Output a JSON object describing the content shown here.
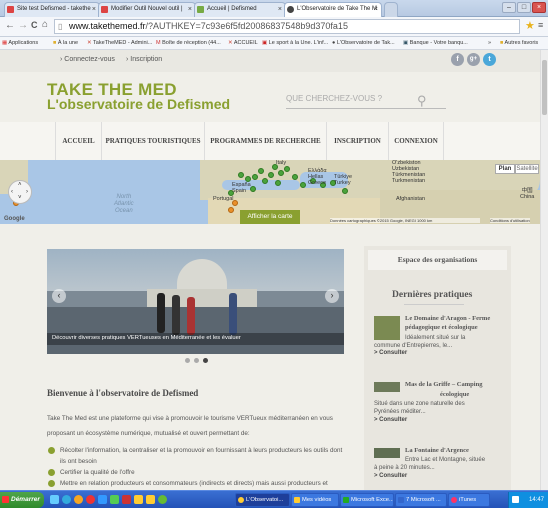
{
  "browser": {
    "tabs": [
      {
        "label": "Site test Defismed - takethe",
        "favicon_color": "#d44"
      },
      {
        "label": "Modifier Outil Nouvel outil |",
        "favicon_color": "#d44"
      },
      {
        "label": "Accueil | Defismed",
        "favicon_color": "#7a4"
      },
      {
        "label": "L'Observatoire de Take The M",
        "favicon_color": "#444"
      }
    ],
    "url_domain": "www.takethemed.fr",
    "url_rest": "/?AUTHKEY=7c93e6f5fd20086837548b9d370fa15",
    "bookmarks": [
      "Applications",
      "À la une",
      "TakeTheMED - Admini...",
      "Boîte de réception (44...",
      "ACCUEIL",
      "Le sport à la Une. L'inf...",
      "L'Observatoire de Tak...",
      "Banque - Votre banqu...",
      "»",
      "Autres favoris"
    ]
  },
  "site": {
    "top_links": [
      "Connectez-vous",
      "Inscription"
    ],
    "social": [
      "f",
      "g+",
      "t"
    ],
    "brand_line1": "TAKE THE MED",
    "brand_line2": "L'observatoire de Defismed",
    "search_placeholder": "QUE CHERCHEZ-VOUS ?",
    "nav": [
      "ACCUEIL",
      "PRATIQUES TOURISTIQUES",
      "PROGRAMMES DE RECHERCHE",
      "INSCRIPTION",
      "CONNEXION"
    ],
    "map": {
      "plan": "Plan",
      "satellite": "Satellite",
      "show_map": "Afficher la carte",
      "footer": "Données cartographiques ©2015 Google, INEGI   1000 km",
      "terms": "Conditions d'utilisation",
      "google": "Google",
      "labels": [
        "España",
        "Spain",
        "Portugal",
        "Italy",
        "Ελλάδα",
        "Hellas",
        "Greece",
        "Türkiye",
        "Turkey",
        "O'zbekiston",
        "Uzbekistan",
        "Türkmenistan",
        "Turkmenistan",
        "Afghanistan",
        "North",
        "Atlantic",
        "Ocean",
        "中国",
        "China"
      ]
    },
    "slider_caption": "Découvrir diverses pratiques VERTueuses en Méditerranée et les évaluer",
    "welcome_title": "Bienvenue à l'observatoire de Defismed",
    "welcome_text1": "Take The Med est une plateforme qui vise à promouvoir le tourisme VERTueux méditerranéen en vous",
    "welcome_text2": "proposant un écosystème numérique, mutualisé et ouvert permettant de:",
    "bullets": [
      "Récolter l'information, la centraliser et la promouvoir en fournissant à leurs producteurs les outils dont",
      "ils ont besoin",
      "Certifier la qualité de l'offre",
      "Mettre en relation producteurs et consommateurs (indirects et directs) mais aussi producteurs et"
    ],
    "orgs_title": "Espace des organisations",
    "latest_title": "Dernières pratiques",
    "practices": [
      {
        "title1": "Le Domaine d'Aragon - Ferme",
        "title2": "pédagogique et écologique",
        "text": [
          "Idéalement situé sur la",
          "commune d'Entrepierres, le..."
        ],
        "more": "> Consulter"
      },
      {
        "title1": "Mas de la Griffe – Camping",
        "title2": "écologique",
        "text": [
          "Situé dans une zone naturelle des",
          "Pyrénées méditer..."
        ],
        "more": "> Consulter"
      },
      {
        "title1": "La Fontaine d'Argence",
        "title2": "",
        "text": [
          "Entre Lac et Montagne, située",
          "à peine à 20 minutes..."
        ],
        "more": "> Consulter"
      }
    ]
  },
  "taskbar": {
    "start": "Démarrer",
    "tasks": [
      "L'Observatoi...",
      "Mes vidéos",
      "Microsoft Exce...",
      "7 Microsoft ...",
      "iTunes"
    ],
    "time": "14:47"
  },
  "colors": {
    "brand_green": "#8aa030",
    "pin_green": "#4aa23c",
    "pin_orange": "#e9902a",
    "taskbar_blue": "#2452b7"
  }
}
